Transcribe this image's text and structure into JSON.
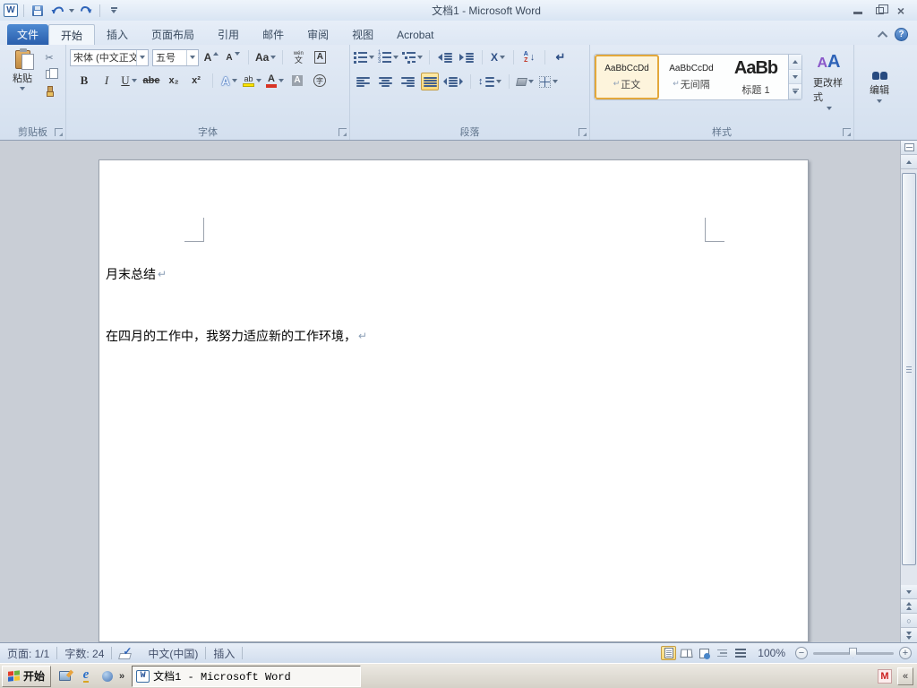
{
  "colors": {
    "accent_blue": "#2b579a",
    "selection_orange": "#e3a83b",
    "file_tab_blue": "#2f6fc1"
  },
  "window": {
    "title": "文档1 - Microsoft Word"
  },
  "qat": {
    "word_icon": "W"
  },
  "tabs": {
    "file": "文件",
    "home": "开始",
    "insert": "插入",
    "page_layout": "页面布局",
    "references": "引用",
    "mailings": "邮件",
    "review": "审阅",
    "view": "视图",
    "acrobat": "Acrobat"
  },
  "ribbon": {
    "clipboard": {
      "group": "剪贴板",
      "paste": "粘贴"
    },
    "font": {
      "group": "字体",
      "name": "宋体 (中文正文",
      "size": "五号",
      "bold": "B",
      "italic": "I",
      "underline": "U",
      "strike": "abe",
      "sub": "x₂",
      "sup": "x²",
      "grow": "A",
      "shrink": "A",
      "case": "Aa",
      "phonetic_top": "wén",
      "phonetic_bottom": "文",
      "border_a": "A",
      "effects": "A",
      "highlight_ab": "ab",
      "color_a": "A",
      "shade_a": "A",
      "enclose": "字"
    },
    "paragraph": {
      "group": "段落",
      "sort_a": "A",
      "sort_z": "Z",
      "pilcrow": "↵",
      "asian": "X",
      "updown": "↕",
      "down_arrow": "↓"
    },
    "styles": {
      "group": "样式",
      "s1_sample": "AaBbCcDd",
      "s1_name": "正文",
      "s2_sample": "AaBbCcDd",
      "s2_name": "无间隔",
      "s3_sample": "AaBb",
      "s3_name": "标题 1",
      "change": "更改样式",
      "change_a1": "A",
      "change_a2": "A"
    },
    "editing": {
      "group": "编辑"
    }
  },
  "doc": {
    "line1": "月末总结",
    "line2": "在四月的工作中，我努力适应新的工作环境，",
    "pilcrow": "↵"
  },
  "status": {
    "page": "页面: 1/1",
    "words": "字数: 24",
    "check": "✓",
    "lang": "中文(中国)",
    "mode": "插入",
    "zoom": "100%",
    "zoom_out": "−",
    "zoom_in": "+"
  },
  "taskbar": {
    "start": "开始",
    "task": "文档1 - Microsoft Word",
    "tray_m": "M",
    "more": "»",
    "collapse": "«",
    "ie": "e"
  },
  "icons": {
    "scissors": "✂",
    "circle": "○",
    "help": "?",
    "close": "×"
  }
}
